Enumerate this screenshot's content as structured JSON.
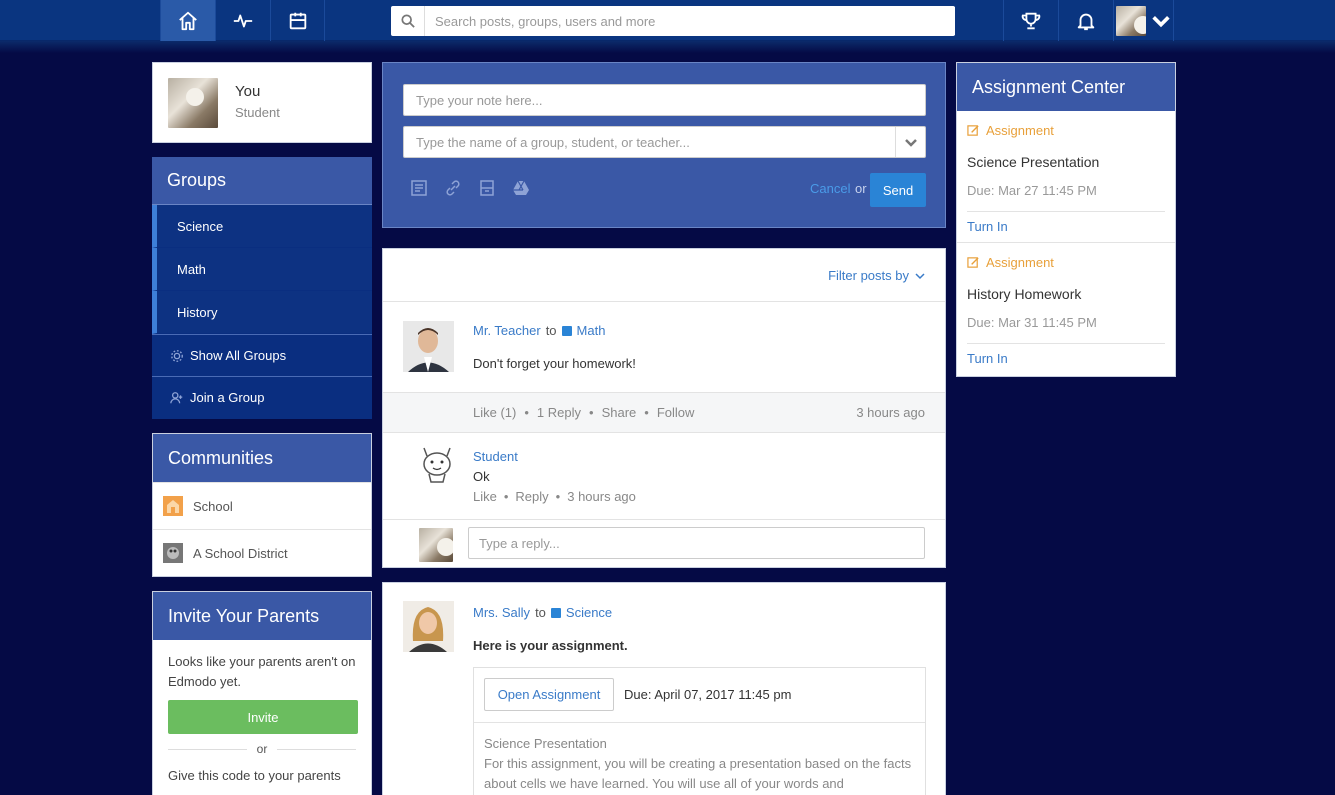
{
  "topbar": {
    "search_placeholder": "Search posts, groups, users and more"
  },
  "profile": {
    "name": "You",
    "role": "Student"
  },
  "groups": {
    "title": "Groups",
    "items": [
      {
        "label": "Science"
      },
      {
        "label": "Math"
      },
      {
        "label": "History"
      }
    ],
    "show_all": "Show All Groups",
    "join": "Join a Group"
  },
  "communities": {
    "title": "Communities",
    "items": [
      {
        "label": "School"
      },
      {
        "label": "A School District"
      }
    ]
  },
  "invite": {
    "title": "Invite Your Parents",
    "text": "Looks like your parents aren't on Edmodo yet.",
    "button": "Invite",
    "or": "or",
    "code_text": "Give this code to your parents"
  },
  "composer": {
    "note_placeholder": "Type your note here...",
    "to_placeholder": "Type the name of a group, student, or teacher...",
    "cancel": "Cancel",
    "or": "or",
    "send": "Send"
  },
  "feed": {
    "filter": "Filter posts by",
    "post1": {
      "author": "Mr. Teacher",
      "to": "to",
      "group": "Math",
      "text": "Don't forget your homework!",
      "like": "Like (1)",
      "reply": "1 Reply",
      "share": "Share",
      "follow": "Follow",
      "time": "3 hours ago",
      "comment": {
        "author": "Student",
        "text": "Ok",
        "like": "Like",
        "reply": "Reply",
        "time": "3 hours ago"
      },
      "reply_placeholder": "Type a reply..."
    },
    "post2": {
      "author": "Mrs. Sally",
      "to": "to",
      "group": "Science",
      "text": "Here is your assignment.",
      "open_button": "Open Assignment",
      "due": "Due: April 07, 2017 11:45 pm",
      "assignment_title": "Science Presentation",
      "assignment_desc": "For this assignment, you will be creating a presentation based on the facts about cells we have learned. You will use all of your words and"
    }
  },
  "assignment_center": {
    "title": "Assignment Center",
    "items": [
      {
        "label": "Assignment",
        "title": "Science Presentation",
        "due": "Due: Mar 27 11:45 PM",
        "action": "Turn In"
      },
      {
        "label": "Assignment",
        "title": "History Homework",
        "due": "Due: Mar 31 11:45 PM",
        "action": "Turn In"
      }
    ]
  },
  "colors": {
    "background": "#050a45",
    "topbar": "#0a3580",
    "panel_header": "#3a58a6",
    "accent_blue": "#2a84d6",
    "invite_green": "#6bbd5f",
    "assignment_orange": "#e8a03a"
  }
}
